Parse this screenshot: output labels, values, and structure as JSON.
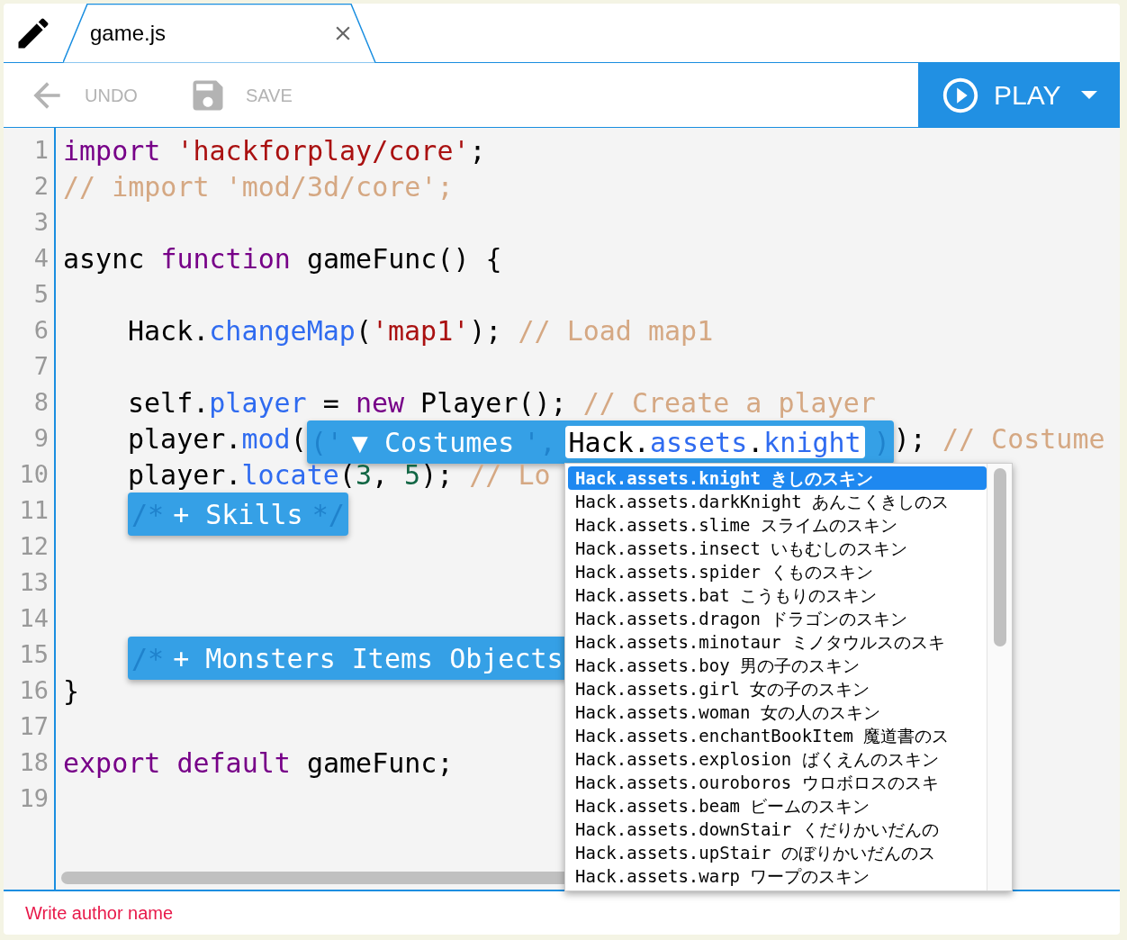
{
  "tab": {
    "title": "game.js",
    "selected": true
  },
  "toolbar": {
    "buttons": [
      {
        "kind": "undo",
        "label": "UNDO",
        "disabled": true
      },
      {
        "kind": "save",
        "label": "SAVE",
        "disabled": true
      }
    ],
    "play": {
      "label": "PLAY"
    }
  },
  "editor": {
    "lines": [
      {
        "number": "1",
        "indent": false,
        "tokens": [
          {
            "kind": "keyword",
            "text": "import"
          },
          {
            "kind": "string",
            "text": " 'hackforplay/core'"
          },
          {
            "kind": "plain",
            "text": ";"
          }
        ]
      },
      {
        "number": "2",
        "indent": false,
        "tokens": [
          {
            "kind": "comment",
            "text": "// import 'mod/3d/core';"
          }
        ]
      },
      {
        "number": "3"
      },
      {
        "number": "4",
        "indent": false,
        "tokens": [
          {
            "kind": "plain",
            "text": "async "
          },
          {
            "kind": "keyword",
            "text": "function"
          },
          {
            "kind": "plain",
            "text": " gameFunc() {"
          }
        ]
      },
      {
        "number": "5"
      },
      {
        "number": "6",
        "indent": true,
        "tokens": [
          {
            "kind": "plain",
            "text": "Hack."
          },
          {
            "kind": "property",
            "text": "changeMap"
          },
          {
            "kind": "plain",
            "text": "("
          },
          {
            "kind": "string",
            "text": "'map1'"
          },
          {
            "kind": "plain",
            "text": "); "
          },
          {
            "kind": "comment",
            "text": "// Load map1"
          }
        ]
      },
      {
        "number": "7"
      },
      {
        "number": "8",
        "indent": true,
        "tokens": [
          {
            "kind": "plain",
            "text": "self."
          },
          {
            "kind": "property",
            "text": "player"
          },
          {
            "kind": "plain",
            "text": " = "
          },
          {
            "kind": "keyword",
            "text": "new"
          },
          {
            "kind": "plain",
            "text": " Player(); "
          },
          {
            "kind": "comment",
            "text": "// Create a player"
          }
        ]
      },
      {
        "number": "9",
        "indent": true,
        "tokens": [
          {
            "kind": "plain",
            "text": "player."
          },
          {
            "kind": "property",
            "text": "mod"
          },
          {
            "kind": "plain",
            "text": "("
          },
          {
            "kind": "widget",
            "parts": [
              {
                "kind": "faded",
                "text": "('"
              },
              {
                "kind": "label",
                "text": "▼ Costumes"
              },
              {
                "kind": "faded",
                "text": "',"
              },
              {
                "kind": "field",
                "tokens": [
                  {
                    "kind": "plain",
                    "text": "Hack."
                  },
                  {
                    "kind": "property",
                    "text": "assets"
                  },
                  {
                    "kind": "plain",
                    "text": "."
                  },
                  {
                    "kind": "property",
                    "text": "knight"
                  }
                ]
              },
              {
                "kind": "faded",
                "text": ")"
              }
            ]
          },
          {
            "kind": "plain",
            "text": "); "
          },
          {
            "kind": "comment",
            "text": "// Costume"
          }
        ]
      },
      {
        "number": "10",
        "indent": true,
        "tokens": [
          {
            "kind": "plain",
            "text": "player."
          },
          {
            "kind": "property",
            "text": "locate"
          },
          {
            "kind": "plain",
            "text": "("
          },
          {
            "kind": "number",
            "text": "3"
          },
          {
            "kind": "plain",
            "text": ", "
          },
          {
            "kind": "number",
            "text": "5"
          },
          {
            "kind": "plain",
            "text": "); "
          },
          {
            "kind": "comment",
            "text": "// Lo"
          }
        ]
      },
      {
        "number": "11",
        "indent": true,
        "tokens": [
          {
            "kind": "widget",
            "parts": [
              {
                "kind": "faded",
                "text": "/*"
              },
              {
                "kind": "label",
                "text": "+ Skills"
              },
              {
                "kind": "faded",
                "text": "*/"
              }
            ]
          }
        ]
      },
      {
        "number": "12"
      },
      {
        "number": "13"
      },
      {
        "number": "14"
      },
      {
        "number": "15",
        "indent": true,
        "tokens": [
          {
            "kind": "widget",
            "parts": [
              {
                "kind": "faded",
                "text": "/*"
              },
              {
                "kind": "label",
                "text": "+ Monsters Items Objects"
              }
            ]
          }
        ]
      },
      {
        "number": "16",
        "indent": false,
        "tokens": [
          {
            "kind": "plain",
            "text": "}"
          }
        ]
      },
      {
        "number": "17"
      },
      {
        "number": "18",
        "indent": false,
        "tokens": [
          {
            "kind": "keyword",
            "text": "export default"
          },
          {
            "kind": "plain",
            "text": " gameFunc;"
          }
        ]
      },
      {
        "number": "19"
      }
    ]
  },
  "autocomplete": {
    "items": [
      {
        "text": "Hack.assets.knight きしのスキン",
        "selected": true
      },
      {
        "text": "Hack.assets.darkKnight あんこくきしのス",
        "selected": false
      },
      {
        "text": "Hack.assets.slime スライムのスキン",
        "selected": false
      },
      {
        "text": "Hack.assets.insect いもむしのスキン",
        "selected": false
      },
      {
        "text": "Hack.assets.spider くものスキン",
        "selected": false
      },
      {
        "text": "Hack.assets.bat こうもりのスキン",
        "selected": false
      },
      {
        "text": "Hack.assets.dragon ドラゴンのスキン",
        "selected": false
      },
      {
        "text": "Hack.assets.minotaur ミノタウルスのスキ",
        "selected": false
      },
      {
        "text": "Hack.assets.boy 男の子のスキン",
        "selected": false
      },
      {
        "text": "Hack.assets.girl 女の子のスキン",
        "selected": false
      },
      {
        "text": "Hack.assets.woman 女の人のスキン",
        "selected": false
      },
      {
        "text": "Hack.assets.enchantBookItem 魔道書のス",
        "selected": false
      },
      {
        "text": "Hack.assets.explosion ばくえんのスキン",
        "selected": false
      },
      {
        "text": "Hack.assets.ouroboros ウロボロスのスキ",
        "selected": false
      },
      {
        "text": "Hack.assets.beam ビームのスキン",
        "selected": false
      },
      {
        "text": "Hack.assets.downStair くだりかいだんの",
        "selected": false
      },
      {
        "text": "Hack.assets.upStair のぼりかいだんのス",
        "selected": false
      },
      {
        "text": "Hack.assets.warp ワープのスキン",
        "selected": false
      }
    ]
  },
  "footer": {
    "author_placeholder": "Write author name"
  }
}
